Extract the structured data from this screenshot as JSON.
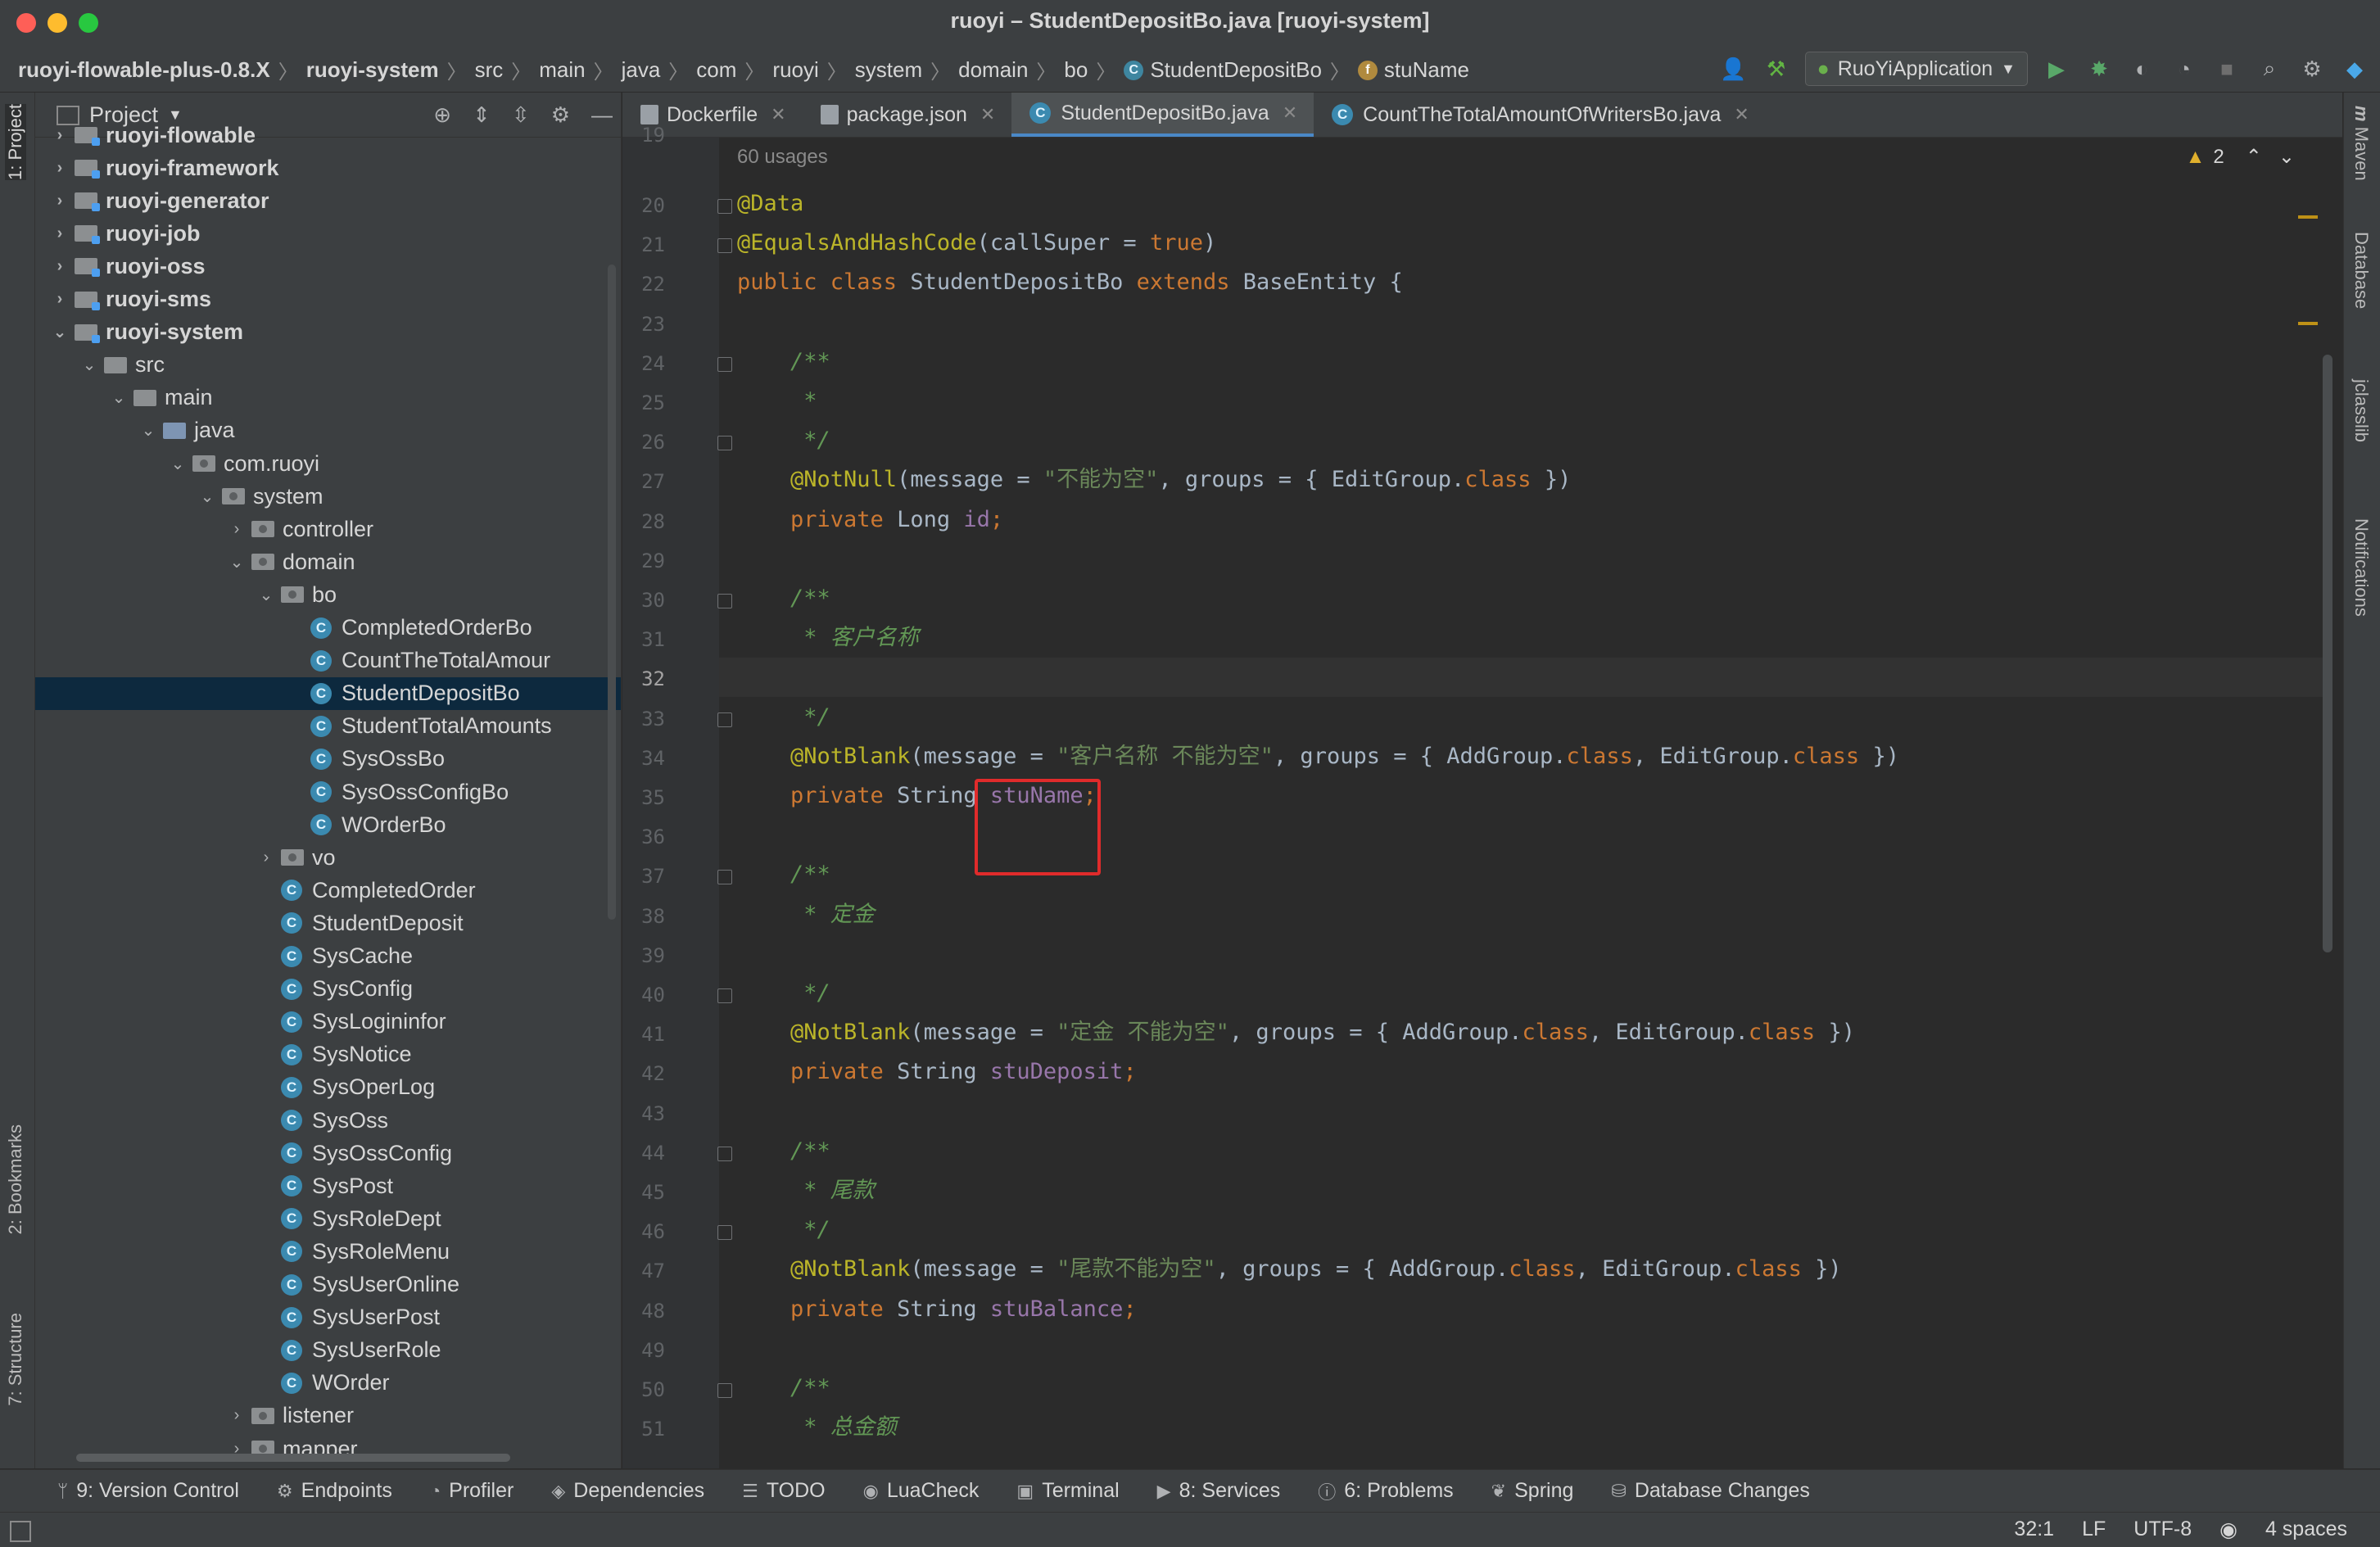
{
  "window": {
    "title": "ruoyi – StudentDepositBo.java [ruoyi-system]"
  },
  "breadcrumbs": [
    "ruoyi-flowable-plus-0.8.X",
    "ruoyi-system",
    "src",
    "main",
    "java",
    "com",
    "ruoyi",
    "system",
    "domain",
    "bo",
    "StudentDepositBo",
    "stuName"
  ],
  "run_config": {
    "label": "RuoYiApplication"
  },
  "project_panel": {
    "title": "Project",
    "tree": [
      {
        "label": "ruoyi-flowable",
        "depth": 0,
        "kind": "module",
        "arrow": "▸"
      },
      {
        "label": "ruoyi-framework",
        "depth": 0,
        "kind": "module",
        "arrow": "▸"
      },
      {
        "label": "ruoyi-generator",
        "depth": 0,
        "kind": "module",
        "arrow": "▸"
      },
      {
        "label": "ruoyi-job",
        "depth": 0,
        "kind": "module",
        "arrow": "▸"
      },
      {
        "label": "ruoyi-oss",
        "depth": 0,
        "kind": "module",
        "arrow": "▸"
      },
      {
        "label": "ruoyi-sms",
        "depth": 0,
        "kind": "module",
        "arrow": "▸"
      },
      {
        "label": "ruoyi-system",
        "depth": 0,
        "kind": "module",
        "arrow": "▾"
      },
      {
        "label": "src",
        "depth": 1,
        "kind": "folder",
        "arrow": "▾"
      },
      {
        "label": "main",
        "depth": 2,
        "kind": "folder",
        "arrow": "▾"
      },
      {
        "label": "java",
        "depth": 3,
        "kind": "src",
        "arrow": "▾"
      },
      {
        "label": "com.ruoyi",
        "depth": 4,
        "kind": "pkg",
        "arrow": "▾"
      },
      {
        "label": "system",
        "depth": 5,
        "kind": "pkg",
        "arrow": "▾"
      },
      {
        "label": "controller",
        "depth": 6,
        "kind": "pkg",
        "arrow": "▸"
      },
      {
        "label": "domain",
        "depth": 6,
        "kind": "pkg",
        "arrow": "▾"
      },
      {
        "label": "bo",
        "depth": 7,
        "kind": "pkg",
        "arrow": "▾"
      },
      {
        "label": "CompletedOrderBo",
        "depth": 8,
        "kind": "class",
        "arrow": ""
      },
      {
        "label": "CountTheTotalAmour",
        "depth": 8,
        "kind": "class",
        "arrow": ""
      },
      {
        "label": "StudentDepositBo",
        "depth": 8,
        "kind": "class",
        "arrow": "",
        "selected": true
      },
      {
        "label": "StudentTotalAmounts",
        "depth": 8,
        "kind": "class",
        "arrow": ""
      },
      {
        "label": "SysOssBo",
        "depth": 8,
        "kind": "class",
        "arrow": ""
      },
      {
        "label": "SysOssConfigBo",
        "depth": 8,
        "kind": "class",
        "arrow": ""
      },
      {
        "label": "WOrderBo",
        "depth": 8,
        "kind": "class",
        "arrow": ""
      },
      {
        "label": "vo",
        "depth": 7,
        "kind": "pkg",
        "arrow": "▸"
      },
      {
        "label": "CompletedOrder",
        "depth": 7,
        "kind": "class",
        "arrow": ""
      },
      {
        "label": "StudentDeposit",
        "depth": 7,
        "kind": "class",
        "arrow": ""
      },
      {
        "label": "SysCache",
        "depth": 7,
        "kind": "class",
        "arrow": ""
      },
      {
        "label": "SysConfig",
        "depth": 7,
        "kind": "class",
        "arrow": ""
      },
      {
        "label": "SysLogininfor",
        "depth": 7,
        "kind": "class",
        "arrow": ""
      },
      {
        "label": "SysNotice",
        "depth": 7,
        "kind": "class",
        "arrow": ""
      },
      {
        "label": "SysOperLog",
        "depth": 7,
        "kind": "class",
        "arrow": ""
      },
      {
        "label": "SysOss",
        "depth": 7,
        "kind": "class",
        "arrow": ""
      },
      {
        "label": "SysOssConfig",
        "depth": 7,
        "kind": "class",
        "arrow": ""
      },
      {
        "label": "SysPost",
        "depth": 7,
        "kind": "class",
        "arrow": ""
      },
      {
        "label": "SysRoleDept",
        "depth": 7,
        "kind": "class",
        "arrow": ""
      },
      {
        "label": "SysRoleMenu",
        "depth": 7,
        "kind": "class",
        "arrow": ""
      },
      {
        "label": "SysUserOnline",
        "depth": 7,
        "kind": "class",
        "arrow": ""
      },
      {
        "label": "SysUserPost",
        "depth": 7,
        "kind": "class",
        "arrow": ""
      },
      {
        "label": "SysUserRole",
        "depth": 7,
        "kind": "class",
        "arrow": ""
      },
      {
        "label": "WOrder",
        "depth": 7,
        "kind": "class",
        "arrow": ""
      },
      {
        "label": "listener",
        "depth": 6,
        "kind": "pkg",
        "arrow": "▸"
      },
      {
        "label": "mapper",
        "depth": 6,
        "kind": "pkg",
        "arrow": "▸"
      }
    ]
  },
  "editor_tabs": [
    {
      "label": "Dockerfile",
      "active": false
    },
    {
      "label": "package.json",
      "active": false
    },
    {
      "label": "StudentDepositBo.java",
      "active": true
    },
    {
      "label": "CountTheTotalAmountOfWritersBo.java",
      "active": false
    }
  ],
  "editor": {
    "usages_hint": "60 usages",
    "warning_count": "2",
    "current_line": 32,
    "lines": [
      {
        "n": 19,
        "tokens": []
      },
      {
        "n": 20,
        "tokens": [
          [
            "ann",
            "@Data"
          ]
        ]
      },
      {
        "n": 21,
        "tokens": [
          [
            "ann",
            "@EqualsAndHashCode"
          ],
          [
            "tx",
            "(callSuper = "
          ],
          [
            "kw",
            "true"
          ],
          [
            "tx",
            ")"
          ]
        ]
      },
      {
        "n": 22,
        "tokens": [
          [
            "kw",
            "public class "
          ],
          [
            "tx",
            "StudentDepositBo "
          ],
          [
            "kw",
            "extends "
          ],
          [
            "tx",
            "BaseEntity {"
          ]
        ]
      },
      {
        "n": 23,
        "tokens": []
      },
      {
        "n": 24,
        "tokens": [
          [
            "cmt",
            "    /**"
          ]
        ]
      },
      {
        "n": 25,
        "tokens": [
          [
            "cmt",
            "     *"
          ]
        ]
      },
      {
        "n": 26,
        "tokens": [
          [
            "cmt",
            "     */"
          ]
        ]
      },
      {
        "n": 27,
        "tokens": [
          [
            "ann",
            "    @NotNull"
          ],
          [
            "tx",
            "(message = "
          ],
          [
            "str",
            "\"不能为空\""
          ],
          [
            "tx",
            ", groups = { EditGroup."
          ],
          [
            "kw",
            "class"
          ],
          [
            "tx",
            " })"
          ]
        ]
      },
      {
        "n": 28,
        "tokens": [
          [
            "kw",
            "    private "
          ],
          [
            "tx",
            "Long "
          ],
          [
            "fld",
            "id"
          ],
          [
            "kw",
            ";"
          ]
        ]
      },
      {
        "n": 29,
        "tokens": []
      },
      {
        "n": 30,
        "tokens": [
          [
            "cmt",
            "    /**"
          ]
        ]
      },
      {
        "n": 31,
        "tokens": [
          [
            "cmt",
            "     * 客户名称"
          ]
        ]
      },
      {
        "n": 32,
        "tokens": []
      },
      {
        "n": 33,
        "tokens": [
          [
            "cmt",
            "     */"
          ]
        ]
      },
      {
        "n": 34,
        "tokens": [
          [
            "ann",
            "    @NotBlank"
          ],
          [
            "tx",
            "(message = "
          ],
          [
            "str",
            "\"客户名称 不能为空\""
          ],
          [
            "tx",
            ", groups = { AddGroup."
          ],
          [
            "kw",
            "class"
          ],
          [
            "tx",
            ", EditGroup."
          ],
          [
            "kw",
            "class"
          ],
          [
            "tx",
            " })"
          ]
        ]
      },
      {
        "n": 35,
        "tokens": [
          [
            "kw",
            "    private "
          ],
          [
            "tx",
            "String "
          ],
          [
            "fld",
            "stuName"
          ],
          [
            "kw",
            ";"
          ]
        ]
      },
      {
        "n": 36,
        "tokens": []
      },
      {
        "n": 37,
        "tokens": [
          [
            "cmt",
            "    /**"
          ]
        ]
      },
      {
        "n": 38,
        "tokens": [
          [
            "cmt",
            "     * 定金"
          ]
        ]
      },
      {
        "n": 39,
        "tokens": []
      },
      {
        "n": 40,
        "tokens": [
          [
            "cmt",
            "     */"
          ]
        ]
      },
      {
        "n": 41,
        "tokens": [
          [
            "ann",
            "    @NotBlank"
          ],
          [
            "tx",
            "(message = "
          ],
          [
            "str",
            "\"定金 不能为空\""
          ],
          [
            "tx",
            ", groups = { AddGroup."
          ],
          [
            "kw",
            "class"
          ],
          [
            "tx",
            ", EditGroup."
          ],
          [
            "kw",
            "class"
          ],
          [
            "tx",
            " })"
          ]
        ]
      },
      {
        "n": 42,
        "tokens": [
          [
            "kw",
            "    private "
          ],
          [
            "tx",
            "String "
          ],
          [
            "fld",
            "stuDeposit"
          ],
          [
            "kw",
            ";"
          ]
        ]
      },
      {
        "n": 43,
        "tokens": []
      },
      {
        "n": 44,
        "tokens": [
          [
            "cmt",
            "    /**"
          ]
        ]
      },
      {
        "n": 45,
        "tokens": [
          [
            "cmt",
            "     * 尾款"
          ]
        ]
      },
      {
        "n": 46,
        "tokens": [
          [
            "cmt",
            "     */"
          ]
        ]
      },
      {
        "n": 47,
        "tokens": [
          [
            "ann",
            "    @NotBlank"
          ],
          [
            "tx",
            "(message = "
          ],
          [
            "str",
            "\"尾款不能为空\""
          ],
          [
            "tx",
            ", groups = { AddGroup."
          ],
          [
            "kw",
            "class"
          ],
          [
            "tx",
            ", EditGroup."
          ],
          [
            "kw",
            "class"
          ],
          [
            "tx",
            " })"
          ]
        ]
      },
      {
        "n": 48,
        "tokens": [
          [
            "kw",
            "    private "
          ],
          [
            "tx",
            "String "
          ],
          [
            "fld",
            "stuBalance"
          ],
          [
            "kw",
            ";"
          ]
        ]
      },
      {
        "n": 49,
        "tokens": []
      },
      {
        "n": 50,
        "tokens": [
          [
            "cmt",
            "    /**"
          ]
        ]
      },
      {
        "n": 51,
        "tokens": [
          [
            "cmt",
            "     * 总金额"
          ]
        ]
      }
    ]
  },
  "left_stripe": {
    "project": "1: Project",
    "bookmarks": "2: Bookmarks",
    "structure": "7: Structure"
  },
  "right_stripe": {
    "maven": "Maven",
    "database": "Database",
    "jclasslib": "jclasslib",
    "notifications": "Notifications"
  },
  "bottom_tools": [
    {
      "label": "9: Version Control",
      "icon": "branch-icon",
      "glyph": "ᛘ"
    },
    {
      "label": "Endpoints",
      "icon": "endpoints-icon",
      "glyph": "⚙"
    },
    {
      "label": "Profiler",
      "icon": "profiler-icon",
      "glyph": "◔"
    },
    {
      "label": "Dependencies",
      "icon": "dependencies-icon",
      "glyph": "◈"
    },
    {
      "label": "TODO",
      "icon": "todo-icon",
      "glyph": "☰"
    },
    {
      "label": "LuaCheck",
      "icon": "luacheck-icon",
      "glyph": "◉"
    },
    {
      "label": "Terminal",
      "icon": "terminal-icon",
      "glyph": "▣"
    },
    {
      "label": "8: Services",
      "icon": "services-icon",
      "glyph": "▶"
    },
    {
      "label": "6: Problems",
      "icon": "problems-icon",
      "glyph": "ⓘ"
    },
    {
      "label": "Spring",
      "icon": "spring-icon",
      "glyph": "❦"
    },
    {
      "label": "Database Changes",
      "icon": "database-changes-icon",
      "glyph": "⛁"
    }
  ],
  "status_bar": {
    "position": "32:1",
    "line_sep": "LF",
    "encoding": "UTF-8",
    "indent": "4 spaces"
  },
  "colors": {
    "keyword": "#cc7832",
    "annotation": "#bbb529",
    "string": "#6a8759",
    "comment": "#629755",
    "field": "#9876aa",
    "highlight_box": "#e02b2b"
  }
}
